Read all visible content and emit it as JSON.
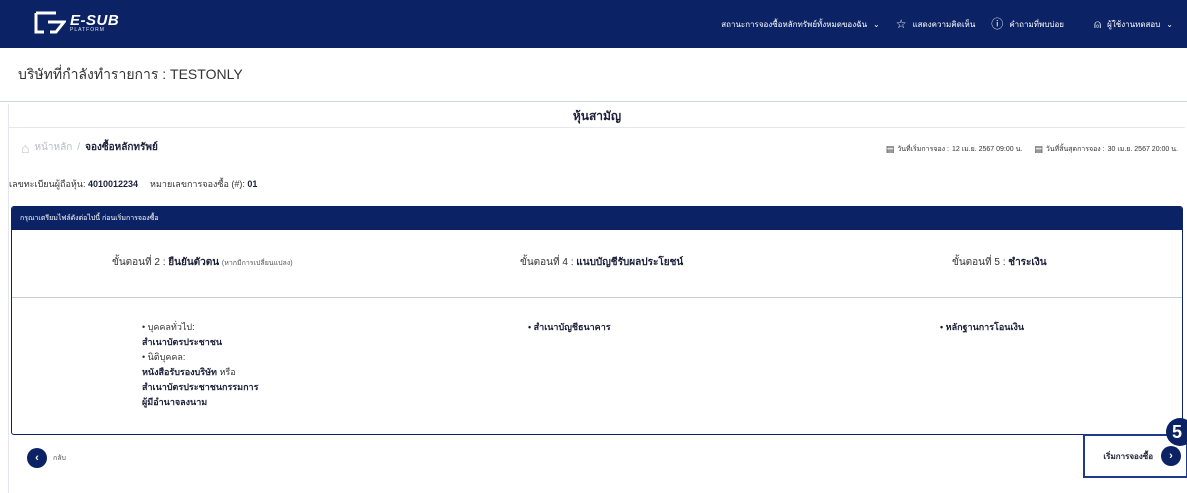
{
  "header": {
    "logo_title": "E-SUB",
    "logo_subtitle": "PLATFORM",
    "nav": [
      {
        "label": "สถานะการจองซื้อหลักทรัพย์ทั้งหมดของฉัน",
        "icon": "chevron-down-icon"
      },
      {
        "label": "แสดงความคิดเห็น",
        "icon": "star-icon"
      },
      {
        "label": "คำถามที่พบบ่อย",
        "icon": "question-circle-icon"
      },
      {
        "label": "ผู้ใช้งานทดสอบ",
        "icon": "user-icon"
      }
    ]
  },
  "company": {
    "label": "บริษัทที่กำลังทำรายการ : TESTONLY"
  },
  "page": {
    "title": "หุ้นสามัญ",
    "breadcrumb": {
      "home": "หน้าหลัก",
      "separator": "/",
      "current": "จองซื้อหลักทรัพย์"
    },
    "dates": [
      {
        "label": "วันที่เริ่มการจอง :",
        "value": "12 เม.ย. 2567 09:00 น."
      },
      {
        "label": "วันที่สิ้นสุดการจอง :",
        "value": "30 เม.ย. 2567 20:00 น."
      }
    ],
    "holder_label": "เลขทะเบียนผู้ถือหุ้น:",
    "holder_value": "4010012234",
    "sub_label": "หมายเลขการจองซื้อ (#):",
    "sub_value": "01"
  },
  "panel": {
    "header": "กรุณาเตรียมไฟล์ดังต่อไปนี้ ก่อนเริ่มการจองซื้อ",
    "steps": [
      {
        "prefix": "ขั้นตอนที่ 2 :",
        "title": "ยืนยันตัวตน",
        "note": "(หากมีการเปลี่ยนแปลง)"
      },
      {
        "prefix": "ขั้นตอนที่ 4 :",
        "title": "แนบบัญชีรับผลประโยชน์",
        "note": ""
      },
      {
        "prefix": "ขั้นตอนที่ 5 :",
        "title": "ชำระเงิน",
        "note": ""
      }
    ],
    "col1": {
      "bullet1": "• บุคคลทั่วไป:",
      "line1": "สำเนาบัตรประชาชน",
      "bullet2": "• นิติบุคคล:",
      "line2a": "หนังสือรับรองบริษัท",
      "line2a_suffix": " หรือ",
      "line2b": "สำเนาบัตรประชาชนกรรมการ",
      "line2c": "ผู้มีอำนาจลงนาม"
    },
    "col2": "• สำเนาบัญชีธนาคาร",
    "col3": "• หลักฐานการโอนเงิน"
  },
  "footer": {
    "back_label": "กลับ",
    "start_label": "เริ่มการจองซื้อ",
    "badge": "5"
  },
  "colors": {
    "primary": "#0b2265",
    "border": "#1e3a8a"
  }
}
